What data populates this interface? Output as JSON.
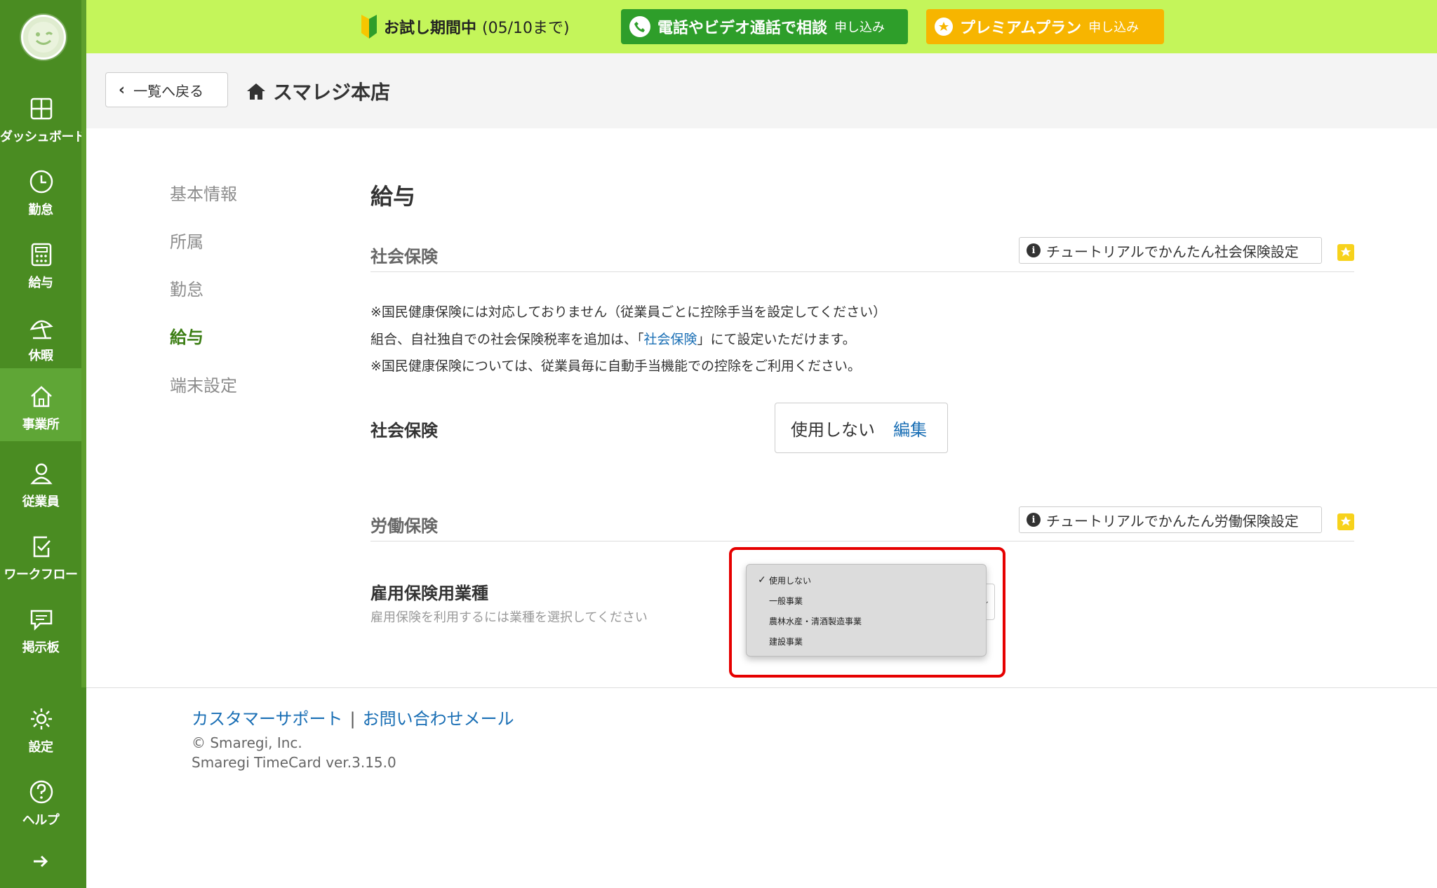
{
  "banner": {
    "trial_label": "お試し期間中",
    "trial_period": "(05/10まで)",
    "consult_label": "電話やビデオ通話で相談",
    "consult_sub": "申し込み",
    "premium_label": "プレミアムプラン",
    "premium_sub": "申し込み"
  },
  "sidebar": {
    "items": [
      {
        "label": "ダッシュボード",
        "icon": "dashboard-icon"
      },
      {
        "label": "勤怠",
        "icon": "clock-icon"
      },
      {
        "label": "給与",
        "icon": "calculator-icon"
      },
      {
        "label": "休暇",
        "icon": "beach-umbrella-icon"
      },
      {
        "label": "事業所",
        "icon": "home-icon"
      },
      {
        "label": "従業員",
        "icon": "person-icon"
      },
      {
        "label": "ワークフロー",
        "icon": "workflow-icon"
      },
      {
        "label": "掲示板",
        "icon": "message-icon"
      },
      {
        "label": "設定",
        "icon": "gear-icon"
      },
      {
        "label": "ヘルプ",
        "icon": "help-icon"
      }
    ],
    "active": "事業所"
  },
  "header": {
    "back_label": "一覧へ戻る",
    "store_name": "スマレジ本店"
  },
  "side_menu": [
    "基本情報",
    "所属",
    "勤怠",
    "給与",
    "端末設定"
  ],
  "main": {
    "title": "給与",
    "social": {
      "heading": "社会保険",
      "tutorial": "チュートリアルでかんたん社会保険設定",
      "note1": "※国民健康保険には対応しておりません（従業員ごとに控除手当を設定してください）",
      "note2_pre": "組合、自社独自での社会保険税率を追加は、「",
      "note2_link": "社会保険",
      "note2_post": "」にて設定いただけます。",
      "note3": "※国民健康保険については、従業員毎に自動手当機能での控除をご利用ください。",
      "field_label": "社会保険",
      "value": "使用しない",
      "edit": "編集"
    },
    "labor": {
      "heading": "労働保険",
      "tutorial": "チュートリアルでかんたん労働保険設定",
      "field_label": "雇用保険用業種",
      "field_help": "雇用保険を利用するには業種を選択してください",
      "options": [
        "使用しない",
        "一般事業",
        "農林水産・清酒製造事業",
        "建設事業"
      ],
      "selected": "使用しない"
    }
  },
  "footer": {
    "support": "カスタマーサポート",
    "separator": "|",
    "contact": "お問い合わせメール",
    "copyright": "© Smaregi, Inc.",
    "version": "Smaregi TimeCard ver.3.15.0"
  },
  "colors": {
    "sidebar": "#4a8c22",
    "banner": "#c4f55a",
    "consult": "#2e9e2a",
    "premium": "#f7b500",
    "link": "#1a6fb5",
    "highlight": "#e60000"
  }
}
